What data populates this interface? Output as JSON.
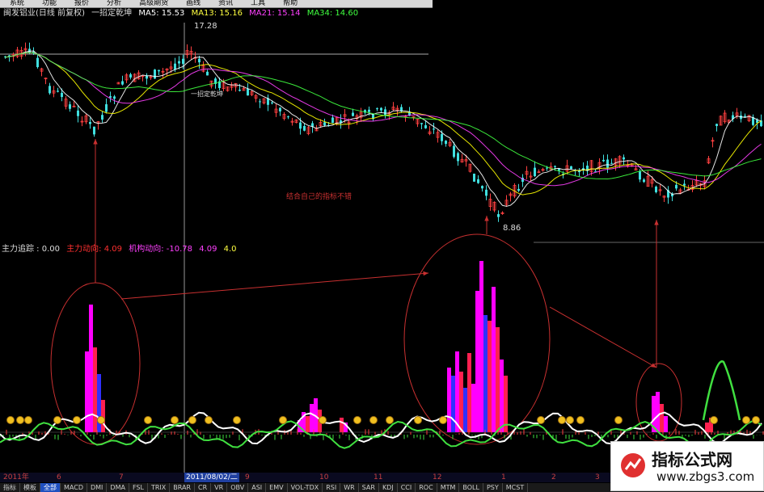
{
  "menu": [
    "系统",
    "功能",
    "报价",
    "分析",
    "高级期货",
    "画线",
    "资讯",
    "工具",
    "帮助"
  ],
  "top_info": {
    "stock": "闽发铝业(日线 前复权)",
    "indicator": "一招定乾坤",
    "ma5": "MA5: 15.53",
    "ma13": "MA13: 15.16",
    "ma21": "MA21: 15.14",
    "ma34": "MA34: 14.60"
  },
  "price_labels": {
    "high": "17.28",
    "low": "8.86",
    "mid_note": "一招定乾坤"
  },
  "annotation": "结合自己的指标不错",
  "sub_info": {
    "name": "主力追踪 : 0.00",
    "zhuli": "主力动向: 4.09",
    "jigou": "机构动向: -10.78",
    "v1": "4.09",
    "v2": "4.0"
  },
  "dates": {
    "year": "2011年",
    "ticks": [
      "6",
      "7",
      "9",
      "10",
      "11",
      "12",
      "1",
      "2",
      "3"
    ],
    "cursor_date": "2011/08/02/二"
  },
  "tabs": [
    "指标",
    "模板",
    "全部",
    "MACD",
    "DMI",
    "DMA",
    "FSL",
    "TRIX",
    "BRAR",
    "CR",
    "VR",
    "OBV",
    "ASI",
    "EMV",
    "VOL-TDX",
    "RSI",
    "WR",
    "SAR",
    "KDJ",
    "CCI",
    "ROC",
    "MTM",
    "BOLL",
    "PSY",
    "MCST"
  ],
  "watermark": {
    "line1": "指标公式网",
    "line2": "www.zbgs3.com"
  },
  "colors": {
    "up": "#ff4040",
    "down": "#40e0e0",
    "ma5": "#ffffff",
    "ma13": "#ffff00",
    "ma21": "#ff40ff",
    "ma34": "#40ff40",
    "magenta_bar": "#ff00ff",
    "red_bar": "#ff2050",
    "blue_bar": "#3030ff",
    "arrow": "#c83030"
  }
}
